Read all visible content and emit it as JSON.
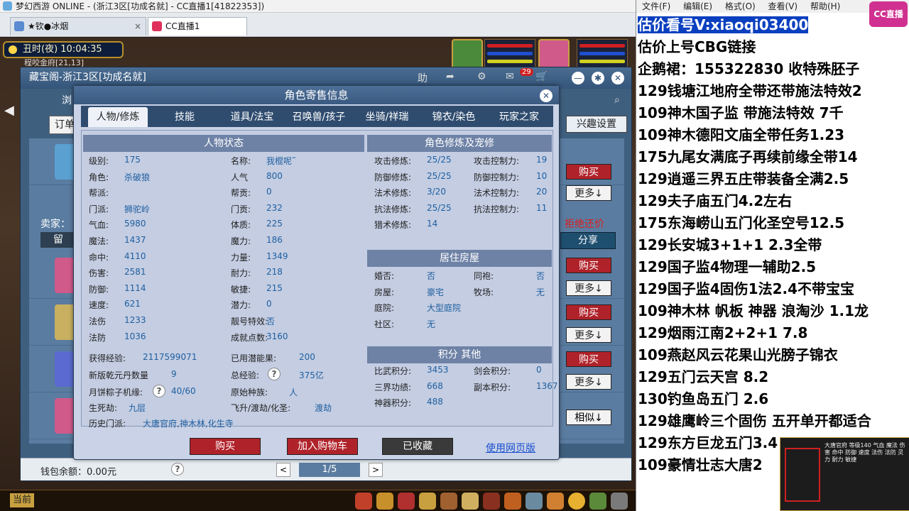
{
  "window": {
    "title": "梦幻西游 ONLINE - (浙江3区[功成名就] - CC直播1[41822353])",
    "tabs": [
      {
        "label": "★钦●冰烟",
        "close": "×"
      },
      {
        "label": "CC直播1"
      }
    ]
  },
  "game": {
    "time": "丑时(夜)  10:04:35",
    "coords": "程咬金府[21,13]"
  },
  "cbg": {
    "title": "藏宝阁-浙江3区[功成名就]",
    "help_label": "助",
    "mail_badge": "29",
    "order_label": "订单",
    "tab_short": "浏",
    "interest_label": "兴趣设置",
    "seller_label": "卖家：",
    "leave_label": "留",
    "reject_label": "拒绝还价",
    "share_label": "分享",
    "buy_label": "购买",
    "more_label": "更多↓",
    "similar_label": "相似↓",
    "wallet_label": "钱包余额：0.00元",
    "page": "1/5",
    "prev": "<",
    "next": ">"
  },
  "dialog": {
    "title": "角色寄售信息",
    "tabs": [
      "人物/修炼",
      "技能",
      "道具/法宝",
      "召唤兽/孩子",
      "坐骑/祥瑞",
      "锦衣/染色",
      "玩家之家"
    ],
    "status_head": "人物状态",
    "cultivation_head": "角色修炼及宠修",
    "house_head": "居住房屋",
    "points_head": "积分 其他",
    "left_col": [
      {
        "k": "级别:",
        "v": "175"
      },
      {
        "k": "角色:",
        "v": "杀破狼"
      },
      {
        "k": "帮派:",
        "v": ""
      },
      {
        "k": "门派:",
        "v": "狮驼岭"
      },
      {
        "k": "气血:",
        "v": "5980"
      },
      {
        "k": "魔法:",
        "v": "1437"
      },
      {
        "k": "命中:",
        "v": "4110"
      },
      {
        "k": "伤害:",
        "v": "2581"
      },
      {
        "k": "防御:",
        "v": "1114"
      },
      {
        "k": "速度:",
        "v": "621"
      },
      {
        "k": "法伤",
        "v": "1233"
      },
      {
        "k": "法防",
        "v": "1036"
      }
    ],
    "right_col": [
      {
        "k": "名称:",
        "v": "我棍呢˜"
      },
      {
        "k": "人气",
        "v": "800"
      },
      {
        "k": "帮贡:",
        "v": "0"
      },
      {
        "k": "门贡:",
        "v": "232"
      },
      {
        "k": "体质:",
        "v": "225"
      },
      {
        "k": "魔力:",
        "v": "186"
      },
      {
        "k": "力量:",
        "v": "1349"
      },
      {
        "k": "耐力:",
        "v": "218"
      },
      {
        "k": "敏捷:",
        "v": "215"
      },
      {
        "k": "潜力:",
        "v": "0"
      },
      {
        "k": "靓号特效:",
        "v": "否"
      },
      {
        "k": "成就点数:",
        "v": "3160"
      }
    ],
    "extra": {
      "exp_label": "获得经验:",
      "exp_val": "2117599071",
      "used_pot_label": "已用潜能果:",
      "used_pot_val": "200",
      "qianyuan_label": "新版乾元丹数量",
      "qianyuan_val": "9",
      "total_exp_label": "总经验:",
      "total_exp_val": "375亿",
      "yuebing_label": "月饼粽子机缘:",
      "yuebing_val": "40/60",
      "race_label": "原始种族:",
      "race_val": "人",
      "shengsi_label": "生死劫:",
      "shengsi_val": "九层",
      "feisheng_label": "飞升/渡劫/化圣:",
      "feisheng_val": "渡劫",
      "history_label": "历史门派:",
      "history_val": "大唐官府,神木林,化生寺"
    },
    "cultivation": [
      {
        "k": "攻击修炼:",
        "v": "25/25",
        "k2": "攻击控制力:",
        "v2": "19"
      },
      {
        "k": "防御修炼:",
        "v": "25/25",
        "k2": "防御控制力:",
        "v2": "10"
      },
      {
        "k": "法术修炼:",
        "v": "3/20",
        "k2": "法术控制力:",
        "v2": "20"
      },
      {
        "k": "抗法修炼:",
        "v": "25/25",
        "k2": "抗法控制力:",
        "v2": "11"
      },
      {
        "k": "猎术修炼:",
        "v": "14",
        "k2": "",
        "v2": ""
      }
    ],
    "house": [
      {
        "k": "婚否:",
        "v": "否",
        "k2": "同袍:",
        "v2": "否"
      },
      {
        "k": "房屋:",
        "v": "豪宅",
        "k2": "牧场:",
        "v2": "无"
      },
      {
        "k": "庭院:",
        "v": "大型庭院",
        "k2": "",
        "v2": ""
      },
      {
        "k": "社区:",
        "v": "无",
        "k2": "",
        "v2": ""
      }
    ],
    "points": [
      {
        "k": "比武积分:",
        "v": "3453",
        "k2": "剑会积分:",
        "v2": "0"
      },
      {
        "k": "三界功绩:",
        "v": "668",
        "k2": "副本积分:",
        "v2": "1367"
      },
      {
        "k": "神器积分:",
        "v": "488",
        "k2": "",
        "v2": ""
      }
    ],
    "buttons": {
      "buy": "购买",
      "cart": "加入购物车",
      "fav": "已收藏",
      "web": "使用网页版"
    }
  },
  "bottombar": {
    "current": "当前"
  },
  "notepad": {
    "menu": [
      "文件(F)",
      "编辑(E)",
      "格式(O)",
      "查看(V)",
      "帮助(H)"
    ],
    "logo": "CC直播",
    "lines": [
      "估价看号V:xiaoqi03400",
      "估价上号CBG链接",
      "企鹅裙：155322830 收特殊胚子",
      "129钱塘江地府全带还带施法特效2",
      "109神木国子监 带施法特效 7千",
      "109神木德阳文庙全带任务1.23",
      "175九尾女满底子再续前缘全带14",
      "129逍遥三界五庄带装备全满2.5",
      "129夫子庙五门4.2左右",
      "175东海崂山五门化圣空号12.5",
      "129长安城3+1+1 2.3全带",
      "129国子监4物理一辅助2.5",
      "129国子监4固伤1法2.4不带宝宝",
      "109神木林 帆板 神器 浪淘沙 1.1龙",
      "129烟雨江南2+2+1 7.8",
      "109燕赵风云花果山光膀子锦衣",
      "129五门云天宫 8.2",
      "130钓鱼岛五门  2.6",
      "129雄鹰岭三个固伤 五开单开都适合",
      "129东方巨龙五门3.4",
      "109豪情壮志大唐2"
    ],
    "cam_text": "大唐官府 等级140 气血 魔法 伤害 命中 防御 速度 法伤 法防 灵力 耐力 敏捷"
  }
}
